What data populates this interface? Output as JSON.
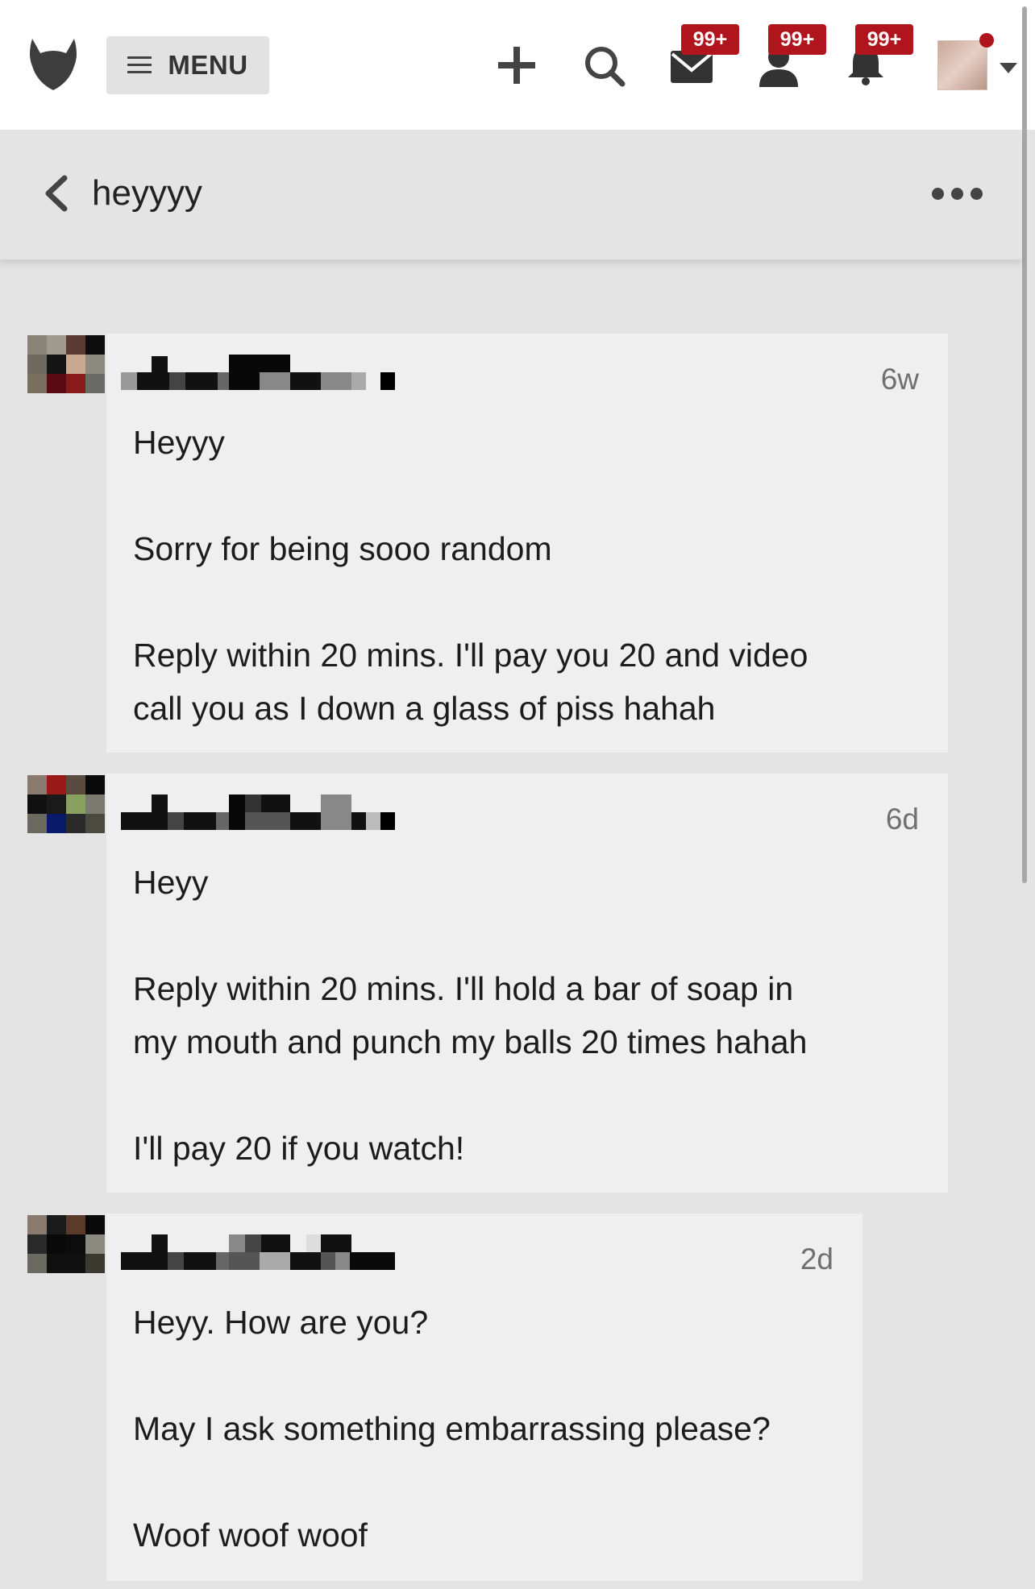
{
  "nav": {
    "menu_label": "MENU",
    "messages_badge": "99+",
    "friends_badge": "99+",
    "notifications_badge": "99+",
    "accent_color": "#b0141d"
  },
  "conversation": {
    "title": "heyyyy"
  },
  "messages": [
    {
      "time": "6w",
      "paragraphs": [
        [
          "Heyyy"
        ],
        [
          "Sorry for being sooo random"
        ],
        [
          "Reply within 20 mins. I'll pay you 20 and video",
          "call you as I down a glass of piss hahah"
        ]
      ]
    },
    {
      "time": "6d",
      "paragraphs": [
        [
          "Heyy"
        ],
        [
          "Reply within 20 mins. I'll hold a bar of soap in",
          "my mouth and punch my balls 20 times hahah"
        ],
        [
          "I'll pay 20 if you watch!"
        ]
      ]
    },
    {
      "time": "2d",
      "paragraphs": [
        [
          "Heyy. How are you?"
        ],
        [
          "May I ask something embarrassing please?"
        ],
        [
          "Woof woof woof"
        ]
      ]
    }
  ]
}
